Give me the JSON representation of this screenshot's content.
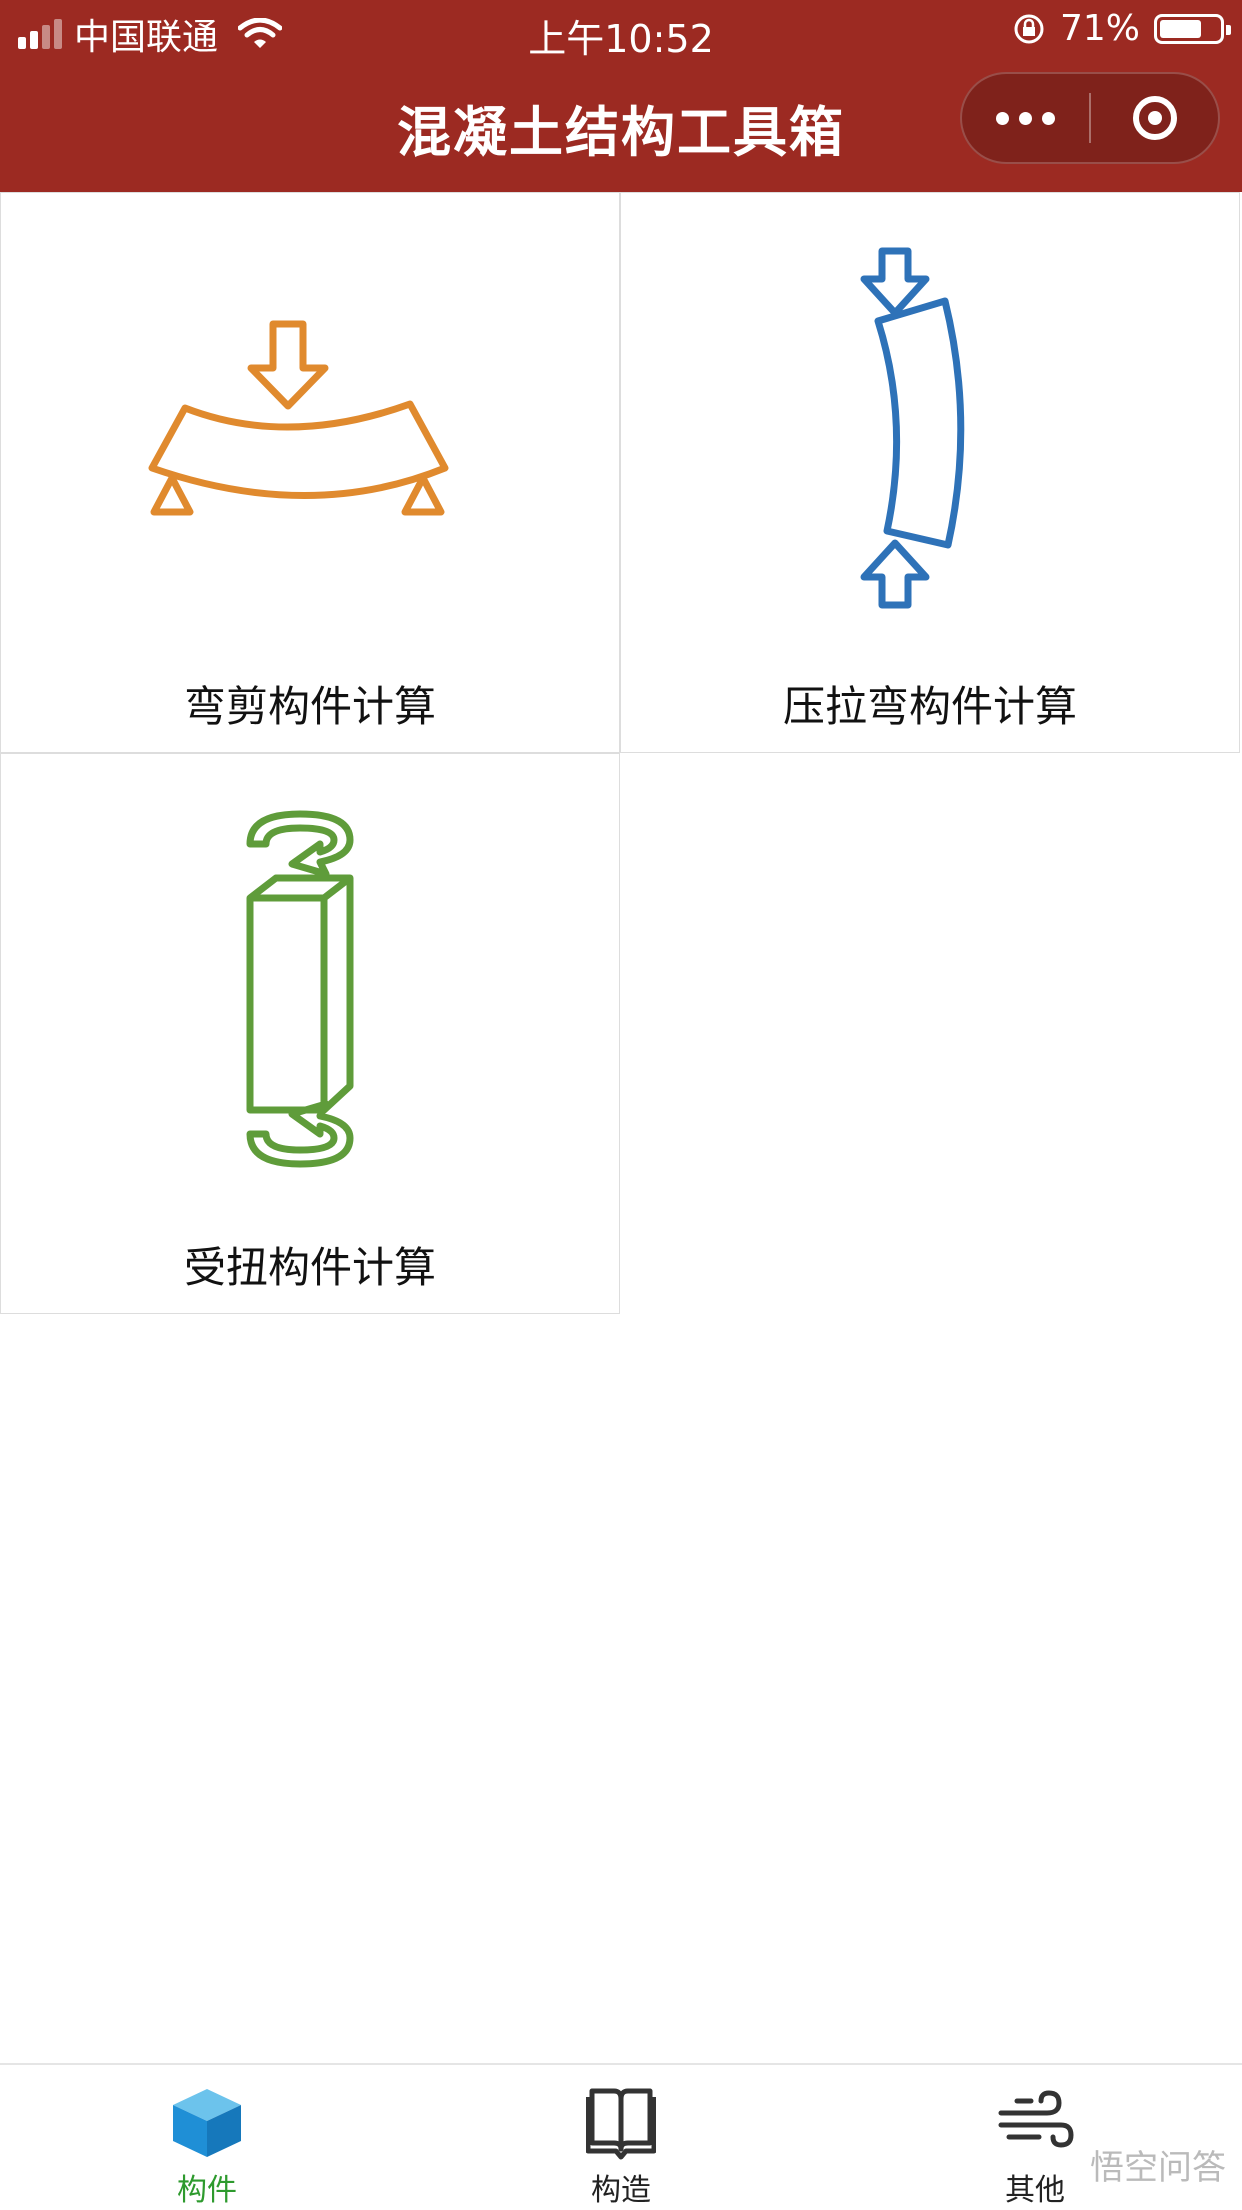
{
  "status_bar": {
    "carrier": "中国联通",
    "time": "上午10:52",
    "battery": "71%",
    "battery_level": 0.71
  },
  "header": {
    "title": "混凝土结构工具箱",
    "menu_icon": "more-dots-icon",
    "close_icon": "target-circle-icon"
  },
  "cards": [
    {
      "label": "弯剪构件计算",
      "icon": "beam-bending-icon",
      "color": "#e08a2e"
    },
    {
      "label": "压拉弯构件计算",
      "icon": "column-compression-icon",
      "color": "#2e72b8"
    },
    {
      "label": "受扭构件计算",
      "icon": "torsion-member-icon",
      "color": "#5f9c3a"
    }
  ],
  "tabs": [
    {
      "label": "构件",
      "icon": "cube-icon",
      "active": true,
      "color": "#2e9a2e"
    },
    {
      "label": "构造",
      "icon": "book-icon",
      "active": false
    },
    {
      "label": "其他",
      "icon": "wind-icon",
      "active": false
    }
  ],
  "watermark": "悟空问答"
}
